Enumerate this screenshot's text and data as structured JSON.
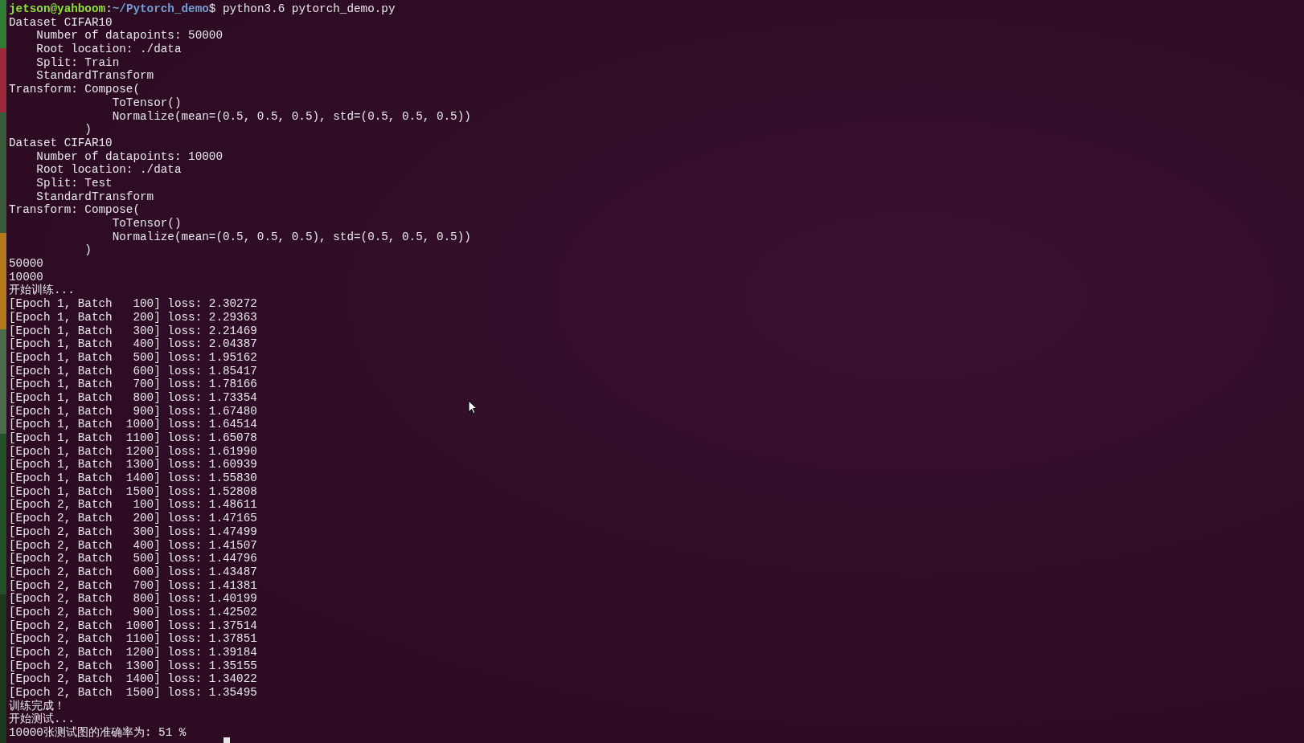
{
  "prompt": {
    "user_host": "jetson@yahboom",
    "separator": ":",
    "path": "~/Pytorch_demo",
    "command": "$ python3.6 pytorch_demo.py"
  },
  "lines": [
    "Dataset CIFAR10",
    "    Number of datapoints: 50000",
    "    Root location: ./data",
    "    Split: Train",
    "    StandardTransform",
    "Transform: Compose(",
    "               ToTensor()",
    "               Normalize(mean=(0.5, 0.5, 0.5), std=(0.5, 0.5, 0.5))",
    "           )",
    "Dataset CIFAR10",
    "    Number of datapoints: 10000",
    "    Root location: ./data",
    "    Split: Test",
    "    StandardTransform",
    "Transform: Compose(",
    "               ToTensor()",
    "               Normalize(mean=(0.5, 0.5, 0.5), std=(0.5, 0.5, 0.5))",
    "           )",
    "50000",
    "10000",
    "开始训练...",
    "[Epoch 1, Batch   100] loss: 2.30272",
    "[Epoch 1, Batch   200] loss: 2.29363",
    "[Epoch 1, Batch   300] loss: 2.21469",
    "[Epoch 1, Batch   400] loss: 2.04387",
    "[Epoch 1, Batch   500] loss: 1.95162",
    "[Epoch 1, Batch   600] loss: 1.85417",
    "[Epoch 1, Batch   700] loss: 1.78166",
    "[Epoch 1, Batch   800] loss: 1.73354",
    "[Epoch 1, Batch   900] loss: 1.67480",
    "[Epoch 1, Batch  1000] loss: 1.64514",
    "[Epoch 1, Batch  1100] loss: 1.65078",
    "[Epoch 1, Batch  1200] loss: 1.61990",
    "[Epoch 1, Batch  1300] loss: 1.60939",
    "[Epoch 1, Batch  1400] loss: 1.55830",
    "[Epoch 1, Batch  1500] loss: 1.52808",
    "[Epoch 2, Batch   100] loss: 1.48611",
    "[Epoch 2, Batch   200] loss: 1.47165",
    "[Epoch 2, Batch   300] loss: 1.47499",
    "[Epoch 2, Batch   400] loss: 1.41507",
    "[Epoch 2, Batch   500] loss: 1.44796",
    "[Epoch 2, Batch   600] loss: 1.43487",
    "[Epoch 2, Batch   700] loss: 1.41381",
    "[Epoch 2, Batch   800] loss: 1.40199",
    "[Epoch 2, Batch   900] loss: 1.42502",
    "[Epoch 2, Batch  1000] loss: 1.37514",
    "[Epoch 2, Batch  1100] loss: 1.37851",
    "[Epoch 2, Batch  1200] loss: 1.39184",
    "[Epoch 2, Batch  1300] loss: 1.35155",
    "[Epoch 2, Batch  1400] loss: 1.34022",
    "[Epoch 2, Batch  1500] loss: 1.35495",
    "训练完成！",
    "开始测试...",
    "10000张测试图的准确率为: 51 %"
  ]
}
